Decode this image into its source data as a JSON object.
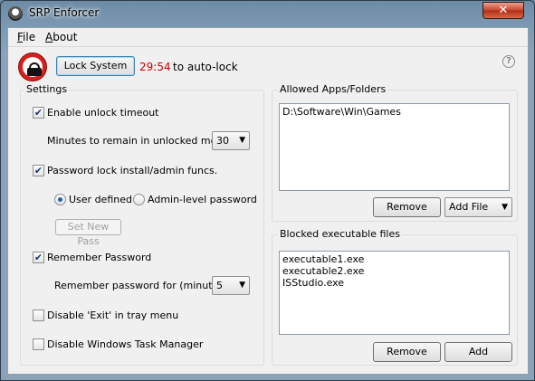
{
  "window": {
    "title": "SRP Enforcer",
    "close_glyph": "✕"
  },
  "menu": {
    "file": "File",
    "about": "About"
  },
  "toolbar": {
    "lock_button": "Lock System",
    "countdown": "29:54",
    "autolock_text": "to auto-lock",
    "help_glyph": "?",
    "lock_icon": "padlock-icon",
    "accent_color": "#d62020"
  },
  "settings": {
    "title": "Settings",
    "enable_unlock_timeout": {
      "label": "Enable unlock timeout",
      "checked": true
    },
    "minutes_label": "Minutes to remain in unlocked mode:",
    "minutes_value": "30",
    "password_lock": {
      "label": "Password lock install/admin funcs.",
      "checked": true
    },
    "radio_user_defined": {
      "label": "User defined",
      "selected": true
    },
    "radio_admin_level": {
      "label": "Admin-level password",
      "selected": false
    },
    "set_new_pass": "Set New Pass",
    "remember_password": {
      "label": "Remember Password",
      "checked": true
    },
    "remember_minutes_label": "Remember password for (minutes):",
    "remember_minutes_value": "5",
    "disable_exit": {
      "label": "Disable 'Exit' in tray menu",
      "checked": false
    },
    "disable_taskmgr": {
      "label": "Disable Windows Task Manager",
      "checked": false
    },
    "check_glyph": "✔"
  },
  "allowed": {
    "title": "Allowed Apps/Folders",
    "items": [
      "D:\\Software\\Win\\Games"
    ],
    "remove_button": "Remove",
    "add_file_button": "Add File"
  },
  "blocked": {
    "title": "Blocked executable files",
    "items": [
      "executable1.exe",
      "executable2.exe",
      "ISStudio.exe"
    ],
    "remove_button": "Remove",
    "add_button": "Add"
  }
}
